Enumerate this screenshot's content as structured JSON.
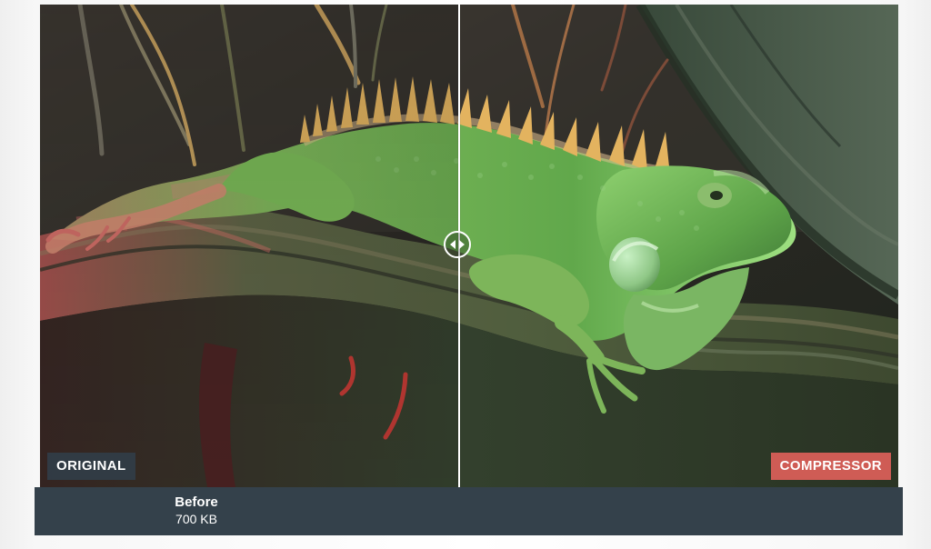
{
  "viewer": {
    "left_label": "ORIGINAL",
    "right_label": "COMPRESSOR"
  },
  "info": {
    "before_title": "Before",
    "before_size": "700 KB"
  },
  "colors": {
    "original_badge": "#313d48",
    "compressor_badge": "#cf5c55",
    "info_bar": "#34414b",
    "divider": "#ffffff"
  },
  "icons": {
    "handle": "left-right-arrows-icon"
  }
}
